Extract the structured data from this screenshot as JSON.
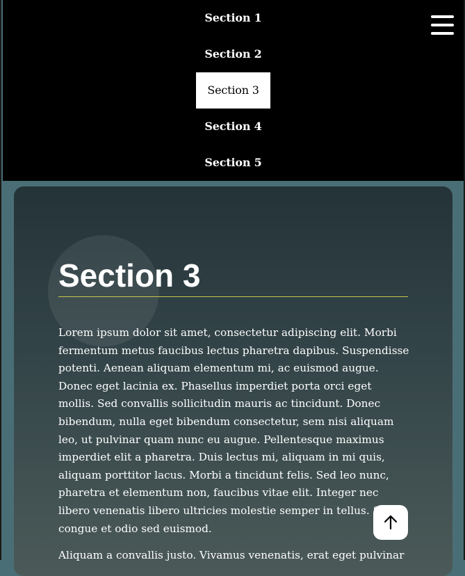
{
  "nav": {
    "items": [
      {
        "label": "Section 1",
        "active": false
      },
      {
        "label": "Section 2",
        "active": false
      },
      {
        "label": "Section 3",
        "active": true
      },
      {
        "label": "Section 4",
        "active": false
      },
      {
        "label": "Section 5",
        "active": false
      }
    ],
    "menu_icon": "hamburger-menu-icon"
  },
  "section": {
    "title": "Section 3",
    "paragraph1": "Lorem ipsum dolor sit amet, consectetur adipiscing elit. Morbi fermentum metus faucibus lectus pharetra dapibus. Suspendisse potenti. Aenean aliquam elementum mi, ac euismod augue. Donec eget lacinia ex. Phasellus imperdiet porta orci eget mollis. Sed convallis sollicitudin mauris ac tincidunt. Donec bibendum, nulla eget bibendum consectetur, sem nisi aliquam leo, ut pulvinar quam nunc eu augue. Pellentesque maximus imperdiet elit a pharetra. Duis lectus mi, aliquam in mi quis, aliquam porttitor lacus. Morbi a tincidunt felis. Sed leo nunc, pharetra et elementum non, faucibus vitae elit. Integer nec libero venenatis libero ultricies molestie semper in tellus. Sed congue et odio sed euismod.",
    "paragraph2": "Aliquam a convallis justo. Vivamus venenatis, erat eget pulvinar"
  },
  "scroll_top": {
    "icon": "arrow-up-icon"
  },
  "colors": {
    "nav_background": "#000000",
    "active_background": "#ffffff",
    "page_background": "#4a6e76",
    "title_underline": "#c8c84a"
  }
}
